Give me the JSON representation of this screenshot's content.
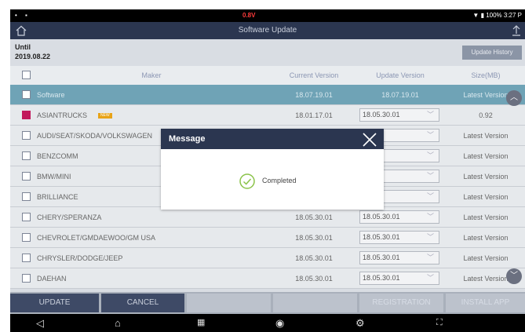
{
  "status_bar": {
    "left_icons": "• ▪",
    "voltage": "0.8V",
    "right": "▼ ▮ 100% 3:27 P"
  },
  "title_bar": {
    "title": "Software Update"
  },
  "until": {
    "label": "Until",
    "date": "2019.08.22"
  },
  "update_history_label": "Update History",
  "table": {
    "columns": [
      "Maker",
      "Current Version",
      "Update Version",
      "Size(MB)"
    ],
    "rows": [
      {
        "maker": "Software",
        "current": "18.07.19.01",
        "update": "18.07.19.01",
        "size": "Latest Version",
        "checked": false,
        "highlight": true
      },
      {
        "maker": "ASIANTRUCKS",
        "badge": "NEW",
        "current": "18.01.17.01",
        "update": "18.05.30.01",
        "size": "0.92",
        "checked": true
      },
      {
        "maker": "AUDI/SEAT/SKODA/VOLKSWAGEN",
        "current": "",
        "update": "30.01",
        "size": "Latest Version",
        "checked": false
      },
      {
        "maker": "BENZCOMM",
        "current": "",
        "update": "30.01",
        "size": "Latest Version",
        "checked": false
      },
      {
        "maker": "BMW/MINI",
        "current": "",
        "update": "30.01",
        "size": "Latest Version",
        "checked": false
      },
      {
        "maker": "BRILLIANCE",
        "current": "",
        "update": "30.01",
        "size": "Latest Version",
        "checked": false
      },
      {
        "maker": "CHERY/SPERANZA",
        "current": "18.05.30.01",
        "update": "18.05.30.01",
        "size": "Latest Version",
        "checked": false
      },
      {
        "maker": "CHEVROLET/GMDAEWOO/GM USA",
        "current": "18.05.30.01",
        "update": "18.05.30.01",
        "size": "Latest Version",
        "checked": false
      },
      {
        "maker": "CHRYSLER/DODGE/JEEP",
        "current": "18.05.30.01",
        "update": "18.05.30.01",
        "size": "Latest Version",
        "checked": false
      },
      {
        "maker": "DAEHAN",
        "current": "18.05.30.01",
        "update": "18.05.30.01",
        "size": "Latest Version",
        "checked": false
      }
    ]
  },
  "bottom_buttons": [
    "UPDATE",
    "CANCEL",
    "",
    "",
    "REGISTRATION",
    "INSTALL APP"
  ],
  "dialog": {
    "title": "Message",
    "message": "Completed"
  },
  "colors": {
    "header": "#2b3650",
    "highlight_row": "#6fa3b6",
    "checked": "#c2185b",
    "success": "#8bc34a"
  }
}
